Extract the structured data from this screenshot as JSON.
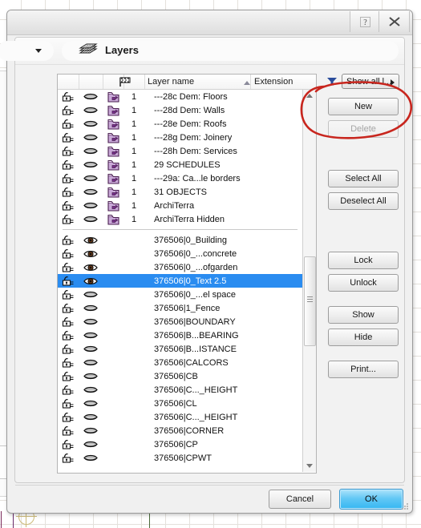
{
  "window": {
    "title": "",
    "help_button": "?",
    "close_button": "✕"
  },
  "panel": {
    "title": "Layers",
    "icon": "layers-stack-icon"
  },
  "list": {
    "columns": {
      "flag_icon": "flag-icon",
      "layer_name": "Layer name",
      "extension": "Extension",
      "sort_indicator": "sort-ascending-icon"
    },
    "selected_row_color": "#2a8cf0",
    "groups": [
      {
        "rows": [
          {
            "lock": "unlocked",
            "visibility": "hidden",
            "folder": "folder-icon",
            "num": "1",
            "name": "---28c  Dem: Floors"
          },
          {
            "lock": "unlocked",
            "visibility": "hidden",
            "folder": "folder-icon",
            "num": "1",
            "name": "---28d  Dem: Walls"
          },
          {
            "lock": "unlocked",
            "visibility": "hidden",
            "folder": "folder-icon",
            "num": "1",
            "name": "---28e  Dem: Roofs"
          },
          {
            "lock": "unlocked",
            "visibility": "hidden",
            "folder": "folder-icon",
            "num": "1",
            "name": "---28g  Dem: Joinery"
          },
          {
            "lock": "unlocked",
            "visibility": "hidden",
            "folder": "folder-icon",
            "num": "1",
            "name": "---28h  Dem: Services"
          },
          {
            "lock": "unlocked",
            "visibility": "hidden",
            "folder": "folder-icon",
            "num": "1",
            "name": "29 SCHEDULES"
          },
          {
            "lock": "unlocked",
            "visibility": "hidden",
            "folder": "folder-icon",
            "num": "1",
            "name": "---29a: Ca...le borders"
          },
          {
            "lock": "unlocked",
            "visibility": "hidden",
            "folder": "folder-icon",
            "num": "1",
            "name": "31 OBJECTS"
          },
          {
            "lock": "unlocked",
            "visibility": "hidden",
            "folder": "folder-icon",
            "num": "1",
            "name": "ArchiTerra"
          },
          {
            "lock": "unlocked",
            "visibility": "hidden",
            "folder": "folder-icon",
            "num": "1",
            "name": "ArchiTerra Hidden"
          }
        ]
      },
      {
        "rows": [
          {
            "lock": "unlocked",
            "visibility": "visible",
            "folder": "",
            "num": "",
            "name": "376506|0_Building",
            "selected": false
          },
          {
            "lock": "unlocked",
            "visibility": "visible",
            "folder": "",
            "num": "",
            "name": "376506|0_...concrete",
            "selected": false
          },
          {
            "lock": "unlocked",
            "visibility": "visible",
            "folder": "",
            "num": "",
            "name": "376506|0_...ofgarden",
            "selected": false
          },
          {
            "lock": "unlocked",
            "visibility": "visible",
            "folder": "",
            "num": "",
            "name": "376506|0_Text 2.5",
            "selected": true
          },
          {
            "lock": "unlocked",
            "visibility": "hidden",
            "folder": "",
            "num": "",
            "name": "376506|0_...el space",
            "selected": false
          },
          {
            "lock": "unlocked",
            "visibility": "hidden",
            "folder": "",
            "num": "",
            "name": "376506|1_Fence",
            "selected": false
          },
          {
            "lock": "unlocked",
            "visibility": "hidden",
            "folder": "",
            "num": "",
            "name": "376506|BOUNDARY",
            "selected": false
          },
          {
            "lock": "unlocked",
            "visibility": "hidden",
            "folder": "",
            "num": "",
            "name": "376506|B...BEARING",
            "selected": false
          },
          {
            "lock": "unlocked",
            "visibility": "hidden",
            "folder": "",
            "num": "",
            "name": "376506|B...ISTANCE",
            "selected": false
          },
          {
            "lock": "unlocked",
            "visibility": "hidden",
            "folder": "",
            "num": "",
            "name": "376506|CALCORS",
            "selected": false
          },
          {
            "lock": "unlocked",
            "visibility": "hidden",
            "folder": "",
            "num": "",
            "name": "376506|CB",
            "selected": false
          },
          {
            "lock": "unlocked",
            "visibility": "hidden",
            "folder": "",
            "num": "",
            "name": "376506|C..._HEIGHT",
            "selected": false
          },
          {
            "lock": "unlocked",
            "visibility": "hidden",
            "folder": "",
            "num": "",
            "name": "376506|CL",
            "selected": false
          },
          {
            "lock": "unlocked",
            "visibility": "hidden",
            "folder": "",
            "num": "",
            "name": "376506|C..._HEIGHT",
            "selected": false
          },
          {
            "lock": "unlocked",
            "visibility": "hidden",
            "folder": "",
            "num": "",
            "name": "376506|CORNER",
            "selected": false
          },
          {
            "lock": "unlocked",
            "visibility": "hidden",
            "folder": "",
            "num": "",
            "name": "376506|CP",
            "selected": false
          },
          {
            "lock": "unlocked",
            "visibility": "hidden",
            "folder": "",
            "num": "",
            "name": "376506|CPWT",
            "selected": false
          }
        ]
      }
    ]
  },
  "side_buttons": {
    "filter_icon": "funnel-icon",
    "show_all": "Show all l...",
    "new": "New",
    "delete": "Delete",
    "select_all": "Select All",
    "deselect_all": "Deselect All",
    "lock": "Lock",
    "unlock": "Unlock",
    "show": "Show",
    "hide": "Hide",
    "print": "Print..."
  },
  "footer": {
    "cancel": "Cancel",
    "ok": "OK"
  },
  "annotation": {
    "type": "hand-drawn-red-circle",
    "color": "#c8261e",
    "encircles": [
      "New",
      "Delete"
    ]
  }
}
